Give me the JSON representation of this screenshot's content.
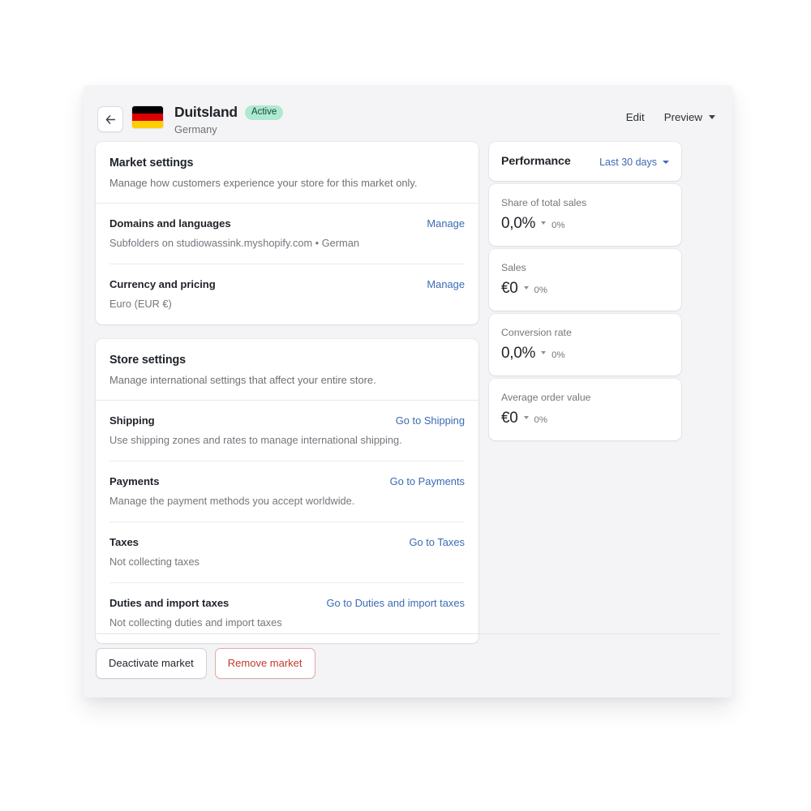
{
  "header": {
    "back_icon": "arrow-left-icon",
    "flag": "germany-flag",
    "title": "Duitsland",
    "badge": "Active",
    "subtitle": "Germany",
    "edit_label": "Edit",
    "preview_label": "Preview"
  },
  "market_settings": {
    "title": "Market settings",
    "description": "Manage how customers experience your store for this market only.",
    "rows": [
      {
        "title": "Domains and languages",
        "description": "Subfolders on studiowassink.myshopify.com • German",
        "action": "Manage"
      },
      {
        "title": "Currency and pricing",
        "description": "Euro (EUR €)",
        "action": "Manage"
      }
    ]
  },
  "store_settings": {
    "title": "Store settings",
    "description": "Manage international settings that affect your entire store.",
    "rows": [
      {
        "title": "Shipping",
        "description": "Use shipping zones and rates to manage international shipping.",
        "action": "Go to Shipping"
      },
      {
        "title": "Payments",
        "description": "Manage the payment methods you accept worldwide.",
        "action": "Go to Payments"
      },
      {
        "title": "Taxes",
        "description": "Not collecting taxes",
        "action": "Go to Taxes"
      },
      {
        "title": "Duties and import taxes",
        "description": "Not collecting duties and import taxes",
        "action": "Go to Duties and import taxes"
      }
    ]
  },
  "performance": {
    "title": "Performance",
    "range": "Last 30 days",
    "metrics": [
      {
        "label": "Share of total sales",
        "value": "0,0%",
        "delta": "0%",
        "trend": "down"
      },
      {
        "label": "Sales",
        "value": "€0",
        "delta": "0%",
        "trend": "down"
      },
      {
        "label": "Conversion rate",
        "value": "0,0%",
        "delta": "0%",
        "trend": "down"
      },
      {
        "label": "Average order value",
        "value": "€0",
        "delta": "0%",
        "trend": "down"
      }
    ]
  },
  "footer": {
    "deactivate_label": "Deactivate market",
    "remove_label": "Remove market"
  },
  "colors": {
    "page_background": "#ffffff",
    "app_background": "#f4f4f6",
    "card_background": "#ffffff",
    "link": "#3c6ab4",
    "badge_background": "#aee9d1",
    "badge_text": "#13493a",
    "danger": "#c5392d",
    "text_primary": "#1f2329",
    "text_secondary": "#73777c"
  }
}
